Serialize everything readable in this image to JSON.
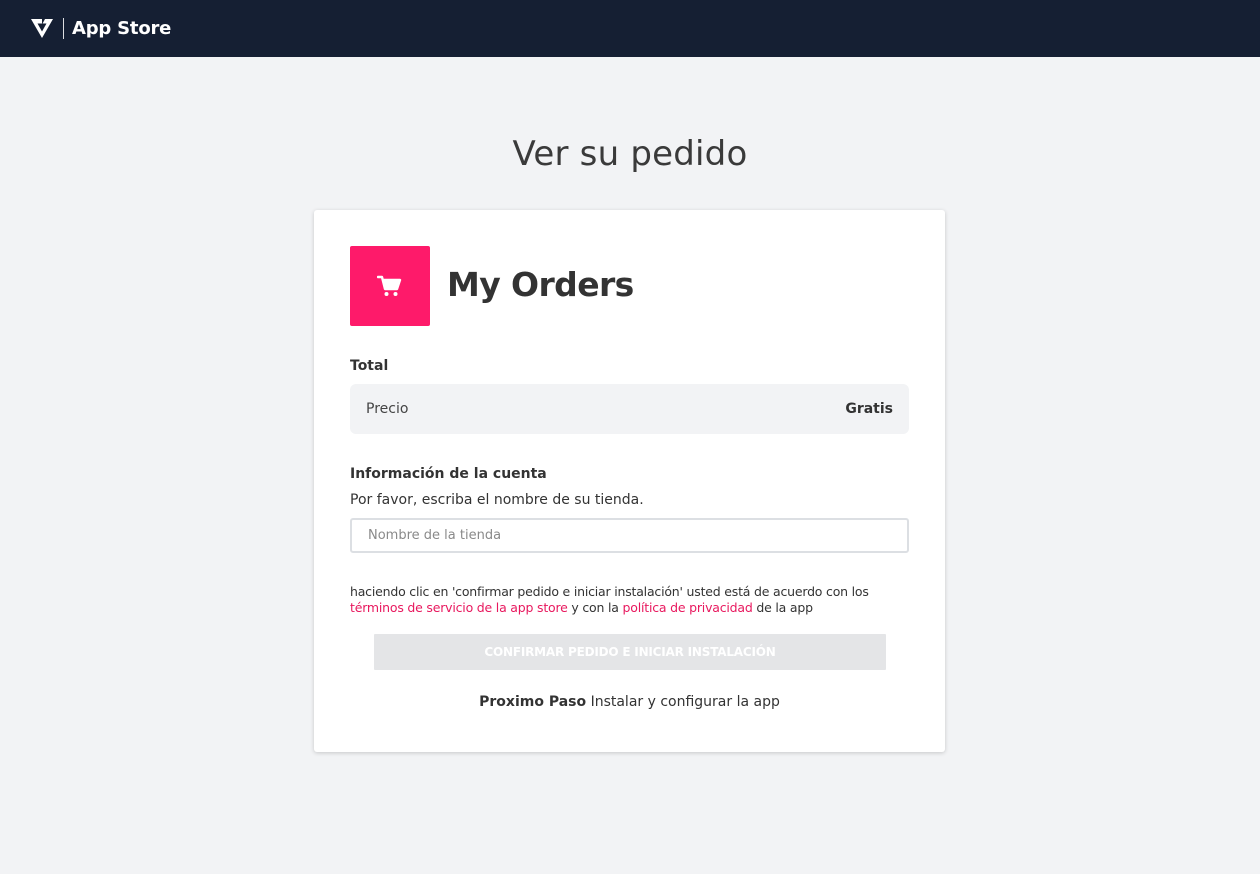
{
  "header": {
    "logo_icon": "brand-logo-icon",
    "brand": "App Store",
    "background": "#151f33"
  },
  "page": {
    "title": "Ver su pedido"
  },
  "app": {
    "icon": "shopping-cart-icon",
    "icon_color": "#fe1a6a",
    "name": "My Orders"
  },
  "total": {
    "label": "Total",
    "price_label": "Precio",
    "price_value": "Gratis"
  },
  "account": {
    "label": "Información de la cuenta",
    "prompt": "Por favor, escriba el nombre de su tienda.",
    "store_input": {
      "value": "",
      "placeholder": "Nombre de la tienda"
    }
  },
  "terms": {
    "prefix": "haciendo clic en 'confirmar pedido e iniciar instalación' usted está de acuerdo con los",
    "tos_link": "términos de servicio de la app store",
    "middle": "y con la",
    "privacy_link": "política de privacidad",
    "suffix": "de la app",
    "link_color": "#e8185e"
  },
  "confirm_button": {
    "label": "CONFIRMAR PEDIDO E INICIAR INSTALACIÓN",
    "state": "disabled"
  },
  "next_step": {
    "label": "Proximo Paso",
    "text": "Instalar y configurar la app"
  }
}
